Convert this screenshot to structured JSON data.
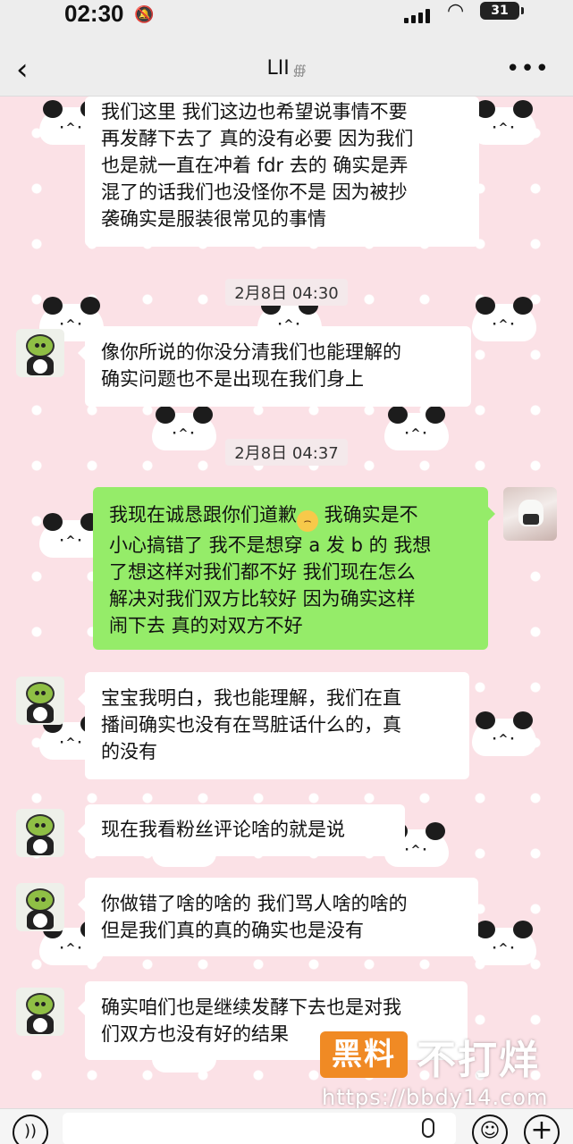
{
  "status_bar": {
    "time": "02:30",
    "battery": "31",
    "icons": [
      "bell-slash-icon",
      "signal-icon",
      "wifi-icon",
      "battery-icon"
    ]
  },
  "header": {
    "back_icon": "chevron-left-icon",
    "title": "LII",
    "title_icon": "ear-icon",
    "more_icon": "more-dots-icon"
  },
  "messages": [
    {
      "side": "left",
      "lines": [
        "我们这里 我们这边也希望说事情不要",
        "再发酵下去了 真的没有必要 因为我们",
        "也是就一直在冲着 fdr 去的 确实是弄",
        "混了的话我们也没怪你不是 因为被抄",
        "袭确实是服装很常见的事情"
      ]
    },
    {
      "timestamp": "2月8日 04:30"
    },
    {
      "side": "left",
      "lines": [
        "像你所说的你没分清我们也能理解的",
        "确实问题也不是出现在我们身上"
      ]
    },
    {
      "timestamp": "2月8日 04:37"
    },
    {
      "side": "right",
      "lines": [
        "我现在诚恳跟你们道歉",
        "小心搞错了  我不是想穿 a 发 b 的 我想",
        "了想这样对我们都不好  我们现在怎么",
        "解决对我们双方比较好 因为确实这样",
        "闹下去 真的对双方不好"
      ],
      "line1_after_emoji": " 我确实是不",
      "emoji": "worried-face-emoji"
    },
    {
      "side": "left",
      "lines": [
        "宝宝我明白，我也能理解，我们在直",
        "播间确实也没有在骂脏话什么的，真",
        "的没有"
      ]
    },
    {
      "side": "left",
      "lines": [
        "现在我看粉丝评论啥的就是说"
      ]
    },
    {
      "side": "left",
      "lines": [
        "你做错了啥的啥的 我们骂人啥的啥的",
        "但是我们真的真的确实也是没有"
      ]
    },
    {
      "side": "left",
      "lines": [
        "确实咱们也是继续发酵下去也是对我",
        "们双方也没有好的结果"
      ]
    }
  ],
  "watermark": {
    "badge": "黑料",
    "text": "不打烊",
    "url": "https://bbdy14.com"
  },
  "input_bar": {
    "placeholder": "",
    "icons": [
      "voice-icon",
      "microphone-icon",
      "emoji-icon",
      "plus-icon"
    ]
  },
  "colors": {
    "sent_bubble": "#95ec69",
    "received_bubble": "#ffffff",
    "wallpaper": "#fbe1e6",
    "header": "#ededed"
  }
}
